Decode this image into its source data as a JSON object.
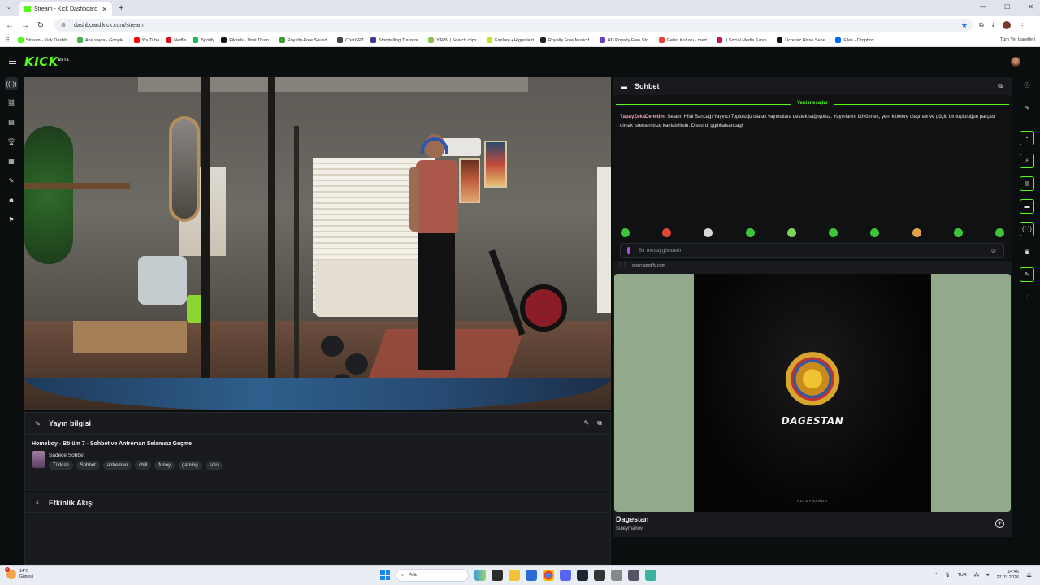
{
  "browser": {
    "tab_title": "Stream - Kick Dashboard",
    "url": "dashboard.kick.com/stream",
    "bookmarks": [
      {
        "label": "Stream - Kick Dashb...",
        "color": "#53fc18"
      },
      {
        "label": "Ana sayfa - Google...",
        "color": "#4caf50"
      },
      {
        "label": "YouTube",
        "color": "#ff0000"
      },
      {
        "label": "Netflix",
        "color": "#e50914"
      },
      {
        "label": "Spotify",
        "color": "#1db954"
      },
      {
        "label": "Pikzels - Viral Thum...",
        "color": "#111111"
      },
      {
        "label": "Royalty-Free Sound...",
        "color": "#3d9a2e"
      },
      {
        "label": "ChatGPT",
        "color": "#444444"
      },
      {
        "label": "Storytelling Transfor...",
        "color": "#3a3a8a"
      },
      {
        "label": "YARN | Search clips...",
        "color": "#8bc34a"
      },
      {
        "label": "Explore • Higgsfield",
        "color": "#c6e51f"
      },
      {
        "label": "Royalty Free Music f...",
        "color": "#222222"
      },
      {
        "label": "HD Royalty Free Sto...",
        "color": "#6a3cc9"
      },
      {
        "label": "Gelen Kutusu - mert...",
        "color": "#ea4335"
      },
      {
        "label": "|| Social Media Sızıcı...",
        "color": "#c2185b"
      },
      {
        "label": "Ücretsiz Hisse Sene...",
        "color": "#111111"
      },
      {
        "label": "Files - Dropbox",
        "color": "#0061fe"
      }
    ],
    "all_bookmarks_label": "Tüm Yer İşaretleri"
  },
  "kick": {
    "logo": "KICK",
    "logo_badge": "BETA"
  },
  "stream_info": {
    "panel_title": "Yayın bilgisi",
    "title": "Homeboy - Bölüm 7 - Sohbet ve Antreman Selamsız Geçme",
    "category": "Sadece Sohbet",
    "tags": [
      "Türkish",
      "Sohbet",
      "antreman",
      "chill",
      "funny",
      "gaming",
      "solo"
    ]
  },
  "activity": {
    "panel_title": "Etkinlik Akışı"
  },
  "chat": {
    "title": "Sohbet",
    "new_messages_label": "Yeni mesajlar",
    "message_user": "YapayZekaDenetim:",
    "message_text": " Selam! Hilal Sancağı Yayıncı Topluluğu olarak yayıncılara destek sağlıyoruz. Yayınlarını büyütmek, yeni kitlelere ulaşmak ve güçlü bir topluluğun parçası olmak istersen bize katılabilirsin. Discord: gg/hilalsancagi",
    "input_placeholder": "Bir mesaj gönderin"
  },
  "spotify": {
    "source": "open.spotify.com",
    "cover_title": "DAGESTAN",
    "cover_artist": "SULEYMANOV",
    "track": "Dagestan",
    "artist": "Suleymanov"
  },
  "taskbar": {
    "temperature": "14°C",
    "weather": "Güneşli",
    "search_placeholder": "Ara",
    "language": "TUR",
    "time": "14:46",
    "date": "27.03.2026",
    "notification_count": "1"
  }
}
